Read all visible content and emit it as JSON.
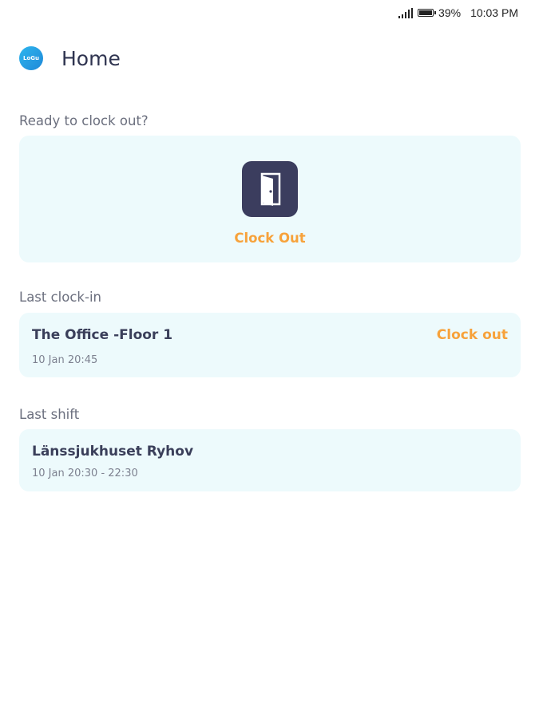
{
  "status_bar": {
    "battery": "39%",
    "time": "10:03 PM",
    "icons": [
      "signal-icon",
      "battery-icon"
    ]
  },
  "header": {
    "logo_text": "LoGu",
    "title": "Home"
  },
  "clock_section": {
    "label": "Ready to clock out?",
    "button_label": "Clock Out",
    "icon": "door-icon"
  },
  "last_clock_in": {
    "label": "Last clock-in",
    "location": "The Office -Floor 1",
    "datetime": "10 Jan  20:45",
    "action_label": "Clock out"
  },
  "last_shift": {
    "label": "Last shift",
    "location": "Länssjukhuset Ryhov",
    "datetime": "10 Jan  20:30 - 22:30"
  },
  "colors": {
    "accent": "#f7a23b",
    "card_bg": "#edfafc",
    "tile_bg": "#3b3d5e",
    "logo_blue": "#1e88d8"
  }
}
